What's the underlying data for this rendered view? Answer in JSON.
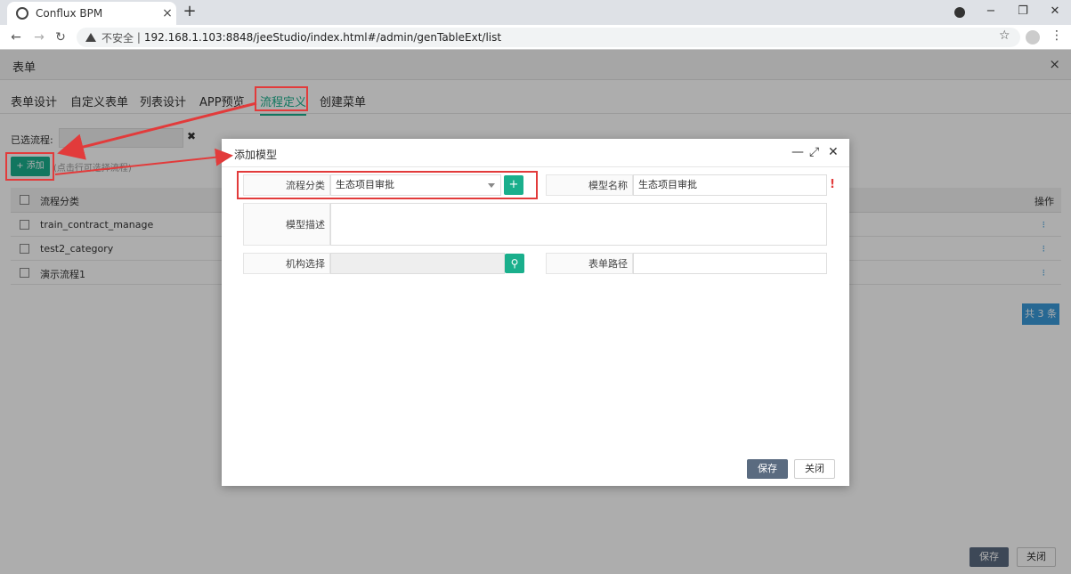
{
  "browser": {
    "tab_title": "Conflux BPM",
    "tab_close": "×",
    "new_tab": "+",
    "not_secure": "不安全",
    "url": "192.168.1.103:8848/jeeStudio/index.html#/admin/genTableExt/list",
    "window_minimize": "−",
    "window_restore": "❐",
    "window_close": "✕"
  },
  "app": {
    "title": "表单",
    "close_glyph": "×",
    "tabs": [
      {
        "label": "表单设计"
      },
      {
        "label": "自定义表单"
      },
      {
        "label": "列表设计"
      },
      {
        "label": "APP预览"
      },
      {
        "label": "流程定义"
      },
      {
        "label": "创建菜单"
      }
    ],
    "selected_label": "已选流程:",
    "clear_glyph": "✖",
    "add_button": "+ 添加",
    "add_hint": "(点击行可选择流程)",
    "grid": {
      "header": "流程分类",
      "op_header": "操作",
      "rows": [
        {
          "name": "train_contract_manage",
          "op": "⁝"
        },
        {
          "name": "test2_category",
          "op": "⁝"
        },
        {
          "name": "演示流程1",
          "op": "⁝"
        }
      ]
    },
    "total": "共 3 条",
    "save": "保存",
    "close": "关闭"
  },
  "modal": {
    "title": "添加模型",
    "minimize": "—",
    "maximize": "⤢",
    "close": "✕",
    "category_label": "流程分类",
    "category_value": "生态项目审批",
    "category_add": "+",
    "model_name_label": "模型名称",
    "model_name_value": "生态项目审批",
    "required_mark": "!",
    "desc_label": "模型描述",
    "desc_value": "",
    "org_label": "机构选择",
    "org_value": "",
    "search_glyph": "⚲",
    "form_path_label": "表单路径",
    "form_path_value": "",
    "save": "保存",
    "close_btn": "关闭"
  },
  "colors": {
    "accent": "#1aaf8c",
    "annotation": "#e23b3b",
    "primary_btn": "#5a6b80",
    "badge": "#3a9ad9"
  }
}
